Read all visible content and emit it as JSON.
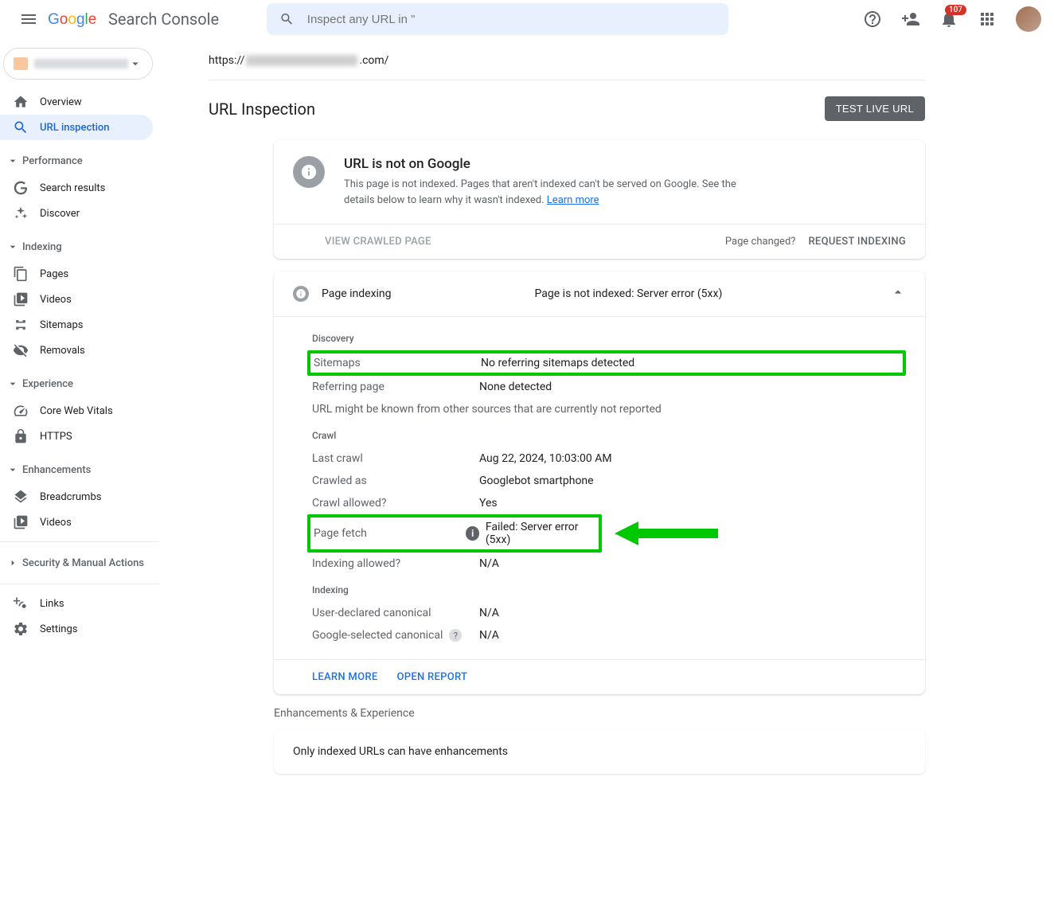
{
  "header": {
    "product": "Search Console",
    "search_placeholder": "Inspect any URL in \"",
    "notifications_count": "107"
  },
  "sidebar": {
    "overview": "Overview",
    "url_inspection": "URL inspection",
    "groups": {
      "performance": "Performance",
      "indexing": "Indexing",
      "experience": "Experience",
      "enhancements": "Enhancements",
      "security": "Security & Manual Actions"
    },
    "items": {
      "search_results": "Search results",
      "discover": "Discover",
      "pages": "Pages",
      "videos": "Videos",
      "sitemaps": "Sitemaps",
      "removals": "Removals",
      "cwv": "Core Web Vitals",
      "https": "HTTPS",
      "breadcrumbs": "Breadcrumbs",
      "videos2": "Videos",
      "links": "Links",
      "settings": "Settings"
    }
  },
  "main": {
    "url_prefix": "https://",
    "url_suffix": ".com/",
    "title": "URL Inspection",
    "test_button": "TEST LIVE URL"
  },
  "status_card": {
    "title": "URL is not on Google",
    "desc": "This page is not indexed. Pages that aren't indexed can't be served on Google. See the details below to learn why it wasn't indexed. ",
    "learn_more": "Learn more",
    "view_crawled": "VIEW CRAWLED PAGE",
    "page_changed": "Page changed?",
    "request_indexing": "REQUEST INDEXING"
  },
  "indexing": {
    "label": "Page indexing",
    "status": "Page is not indexed: Server error (5xx)",
    "discovery": {
      "heading": "Discovery",
      "sitemaps_k": "Sitemaps",
      "sitemaps_v": "No referring sitemaps detected",
      "referring_k": "Referring page",
      "referring_v": "None detected",
      "note": "URL might be known from other sources that are currently not reported"
    },
    "crawl": {
      "heading": "Crawl",
      "last_crawl_k": "Last crawl",
      "last_crawl_v": "Aug 22, 2024, 10:03:00 AM",
      "crawled_as_k": "Crawled as",
      "crawled_as_v": "Googlebot smartphone",
      "crawl_allowed_k": "Crawl allowed?",
      "crawl_allowed_v": "Yes",
      "page_fetch_k": "Page fetch",
      "page_fetch_v": "Failed: Server error (5xx)",
      "index_allowed_k": "Indexing allowed?",
      "index_allowed_v": "N/A"
    },
    "indexing_section": {
      "heading": "Indexing",
      "user_canon_k": "User-declared canonical",
      "user_canon_v": "N/A",
      "google_canon_k": "Google-selected canonical",
      "google_canon_v": "N/A"
    },
    "learn_more": "LEARN MORE",
    "open_report": "OPEN REPORT"
  },
  "enhancements": {
    "label": "Enhancements & Experience",
    "message": "Only indexed URLs can have enhancements"
  }
}
